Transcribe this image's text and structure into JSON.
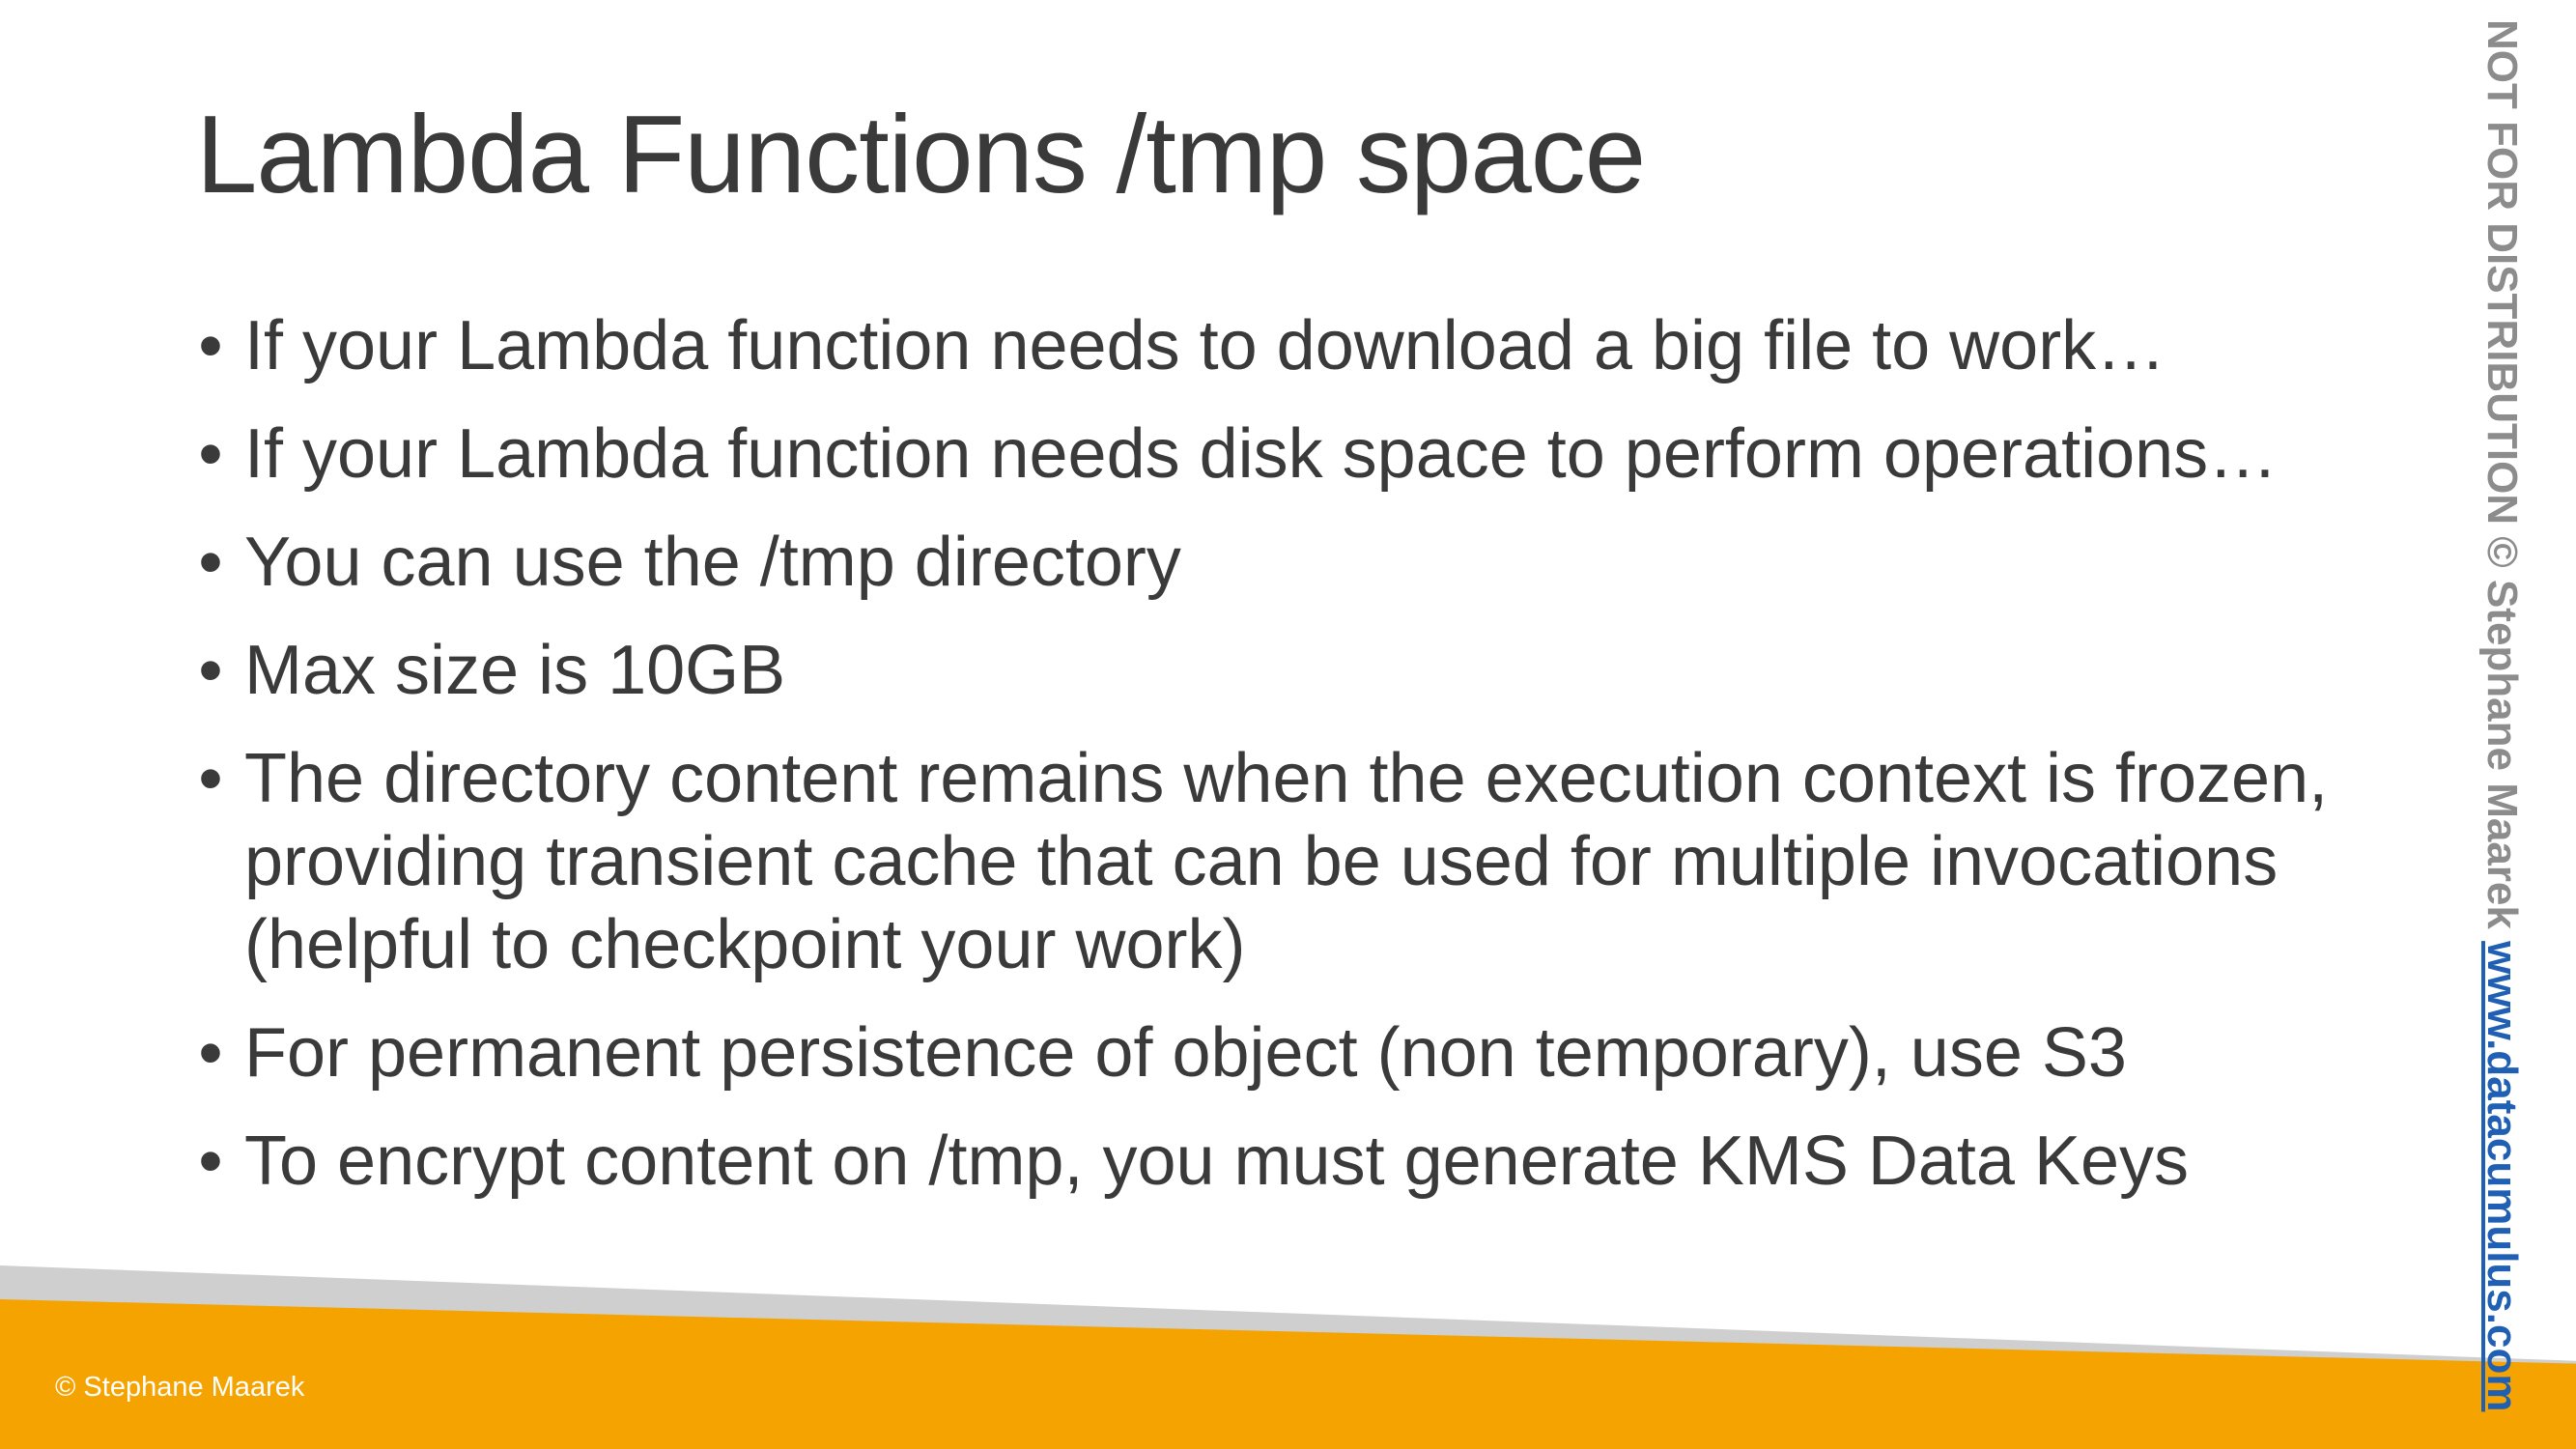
{
  "slide": {
    "title": "Lambda Functions /tmp space",
    "bullet_symbol": "•",
    "bullets": [
      {
        "text": "If your Lambda function needs to download a big file to work…"
      },
      {
        "text": "If your Lambda function needs disk space to perform operations…"
      },
      {
        "text": "You can use the /tmp directory"
      },
      {
        "text": "Max size is 10GB"
      },
      {
        "text": "The directory content remains when the execution context is frozen, providing transient cache that can be used for multiple invocations (helpful to checkpoint your work)"
      },
      {
        "text": "For permanent persistence of object (non temporary), use S3"
      },
      {
        "text": "To encrypt content on /tmp, you must generate KMS Data Keys"
      }
    ],
    "footer": {
      "copyright": "© Stephane Maarek"
    },
    "side_banner": {
      "notice": "NOT FOR DISTRIBUTION © Stephane Maarek",
      "website": "www.datacumulus.com"
    },
    "colors": {
      "text": "#3a3a3a",
      "footer_orange": "#f5a300",
      "footer_gray": "#cfcfcf",
      "notice_gray": "#8c8c8c",
      "link_blue": "#1f5fb4"
    }
  }
}
